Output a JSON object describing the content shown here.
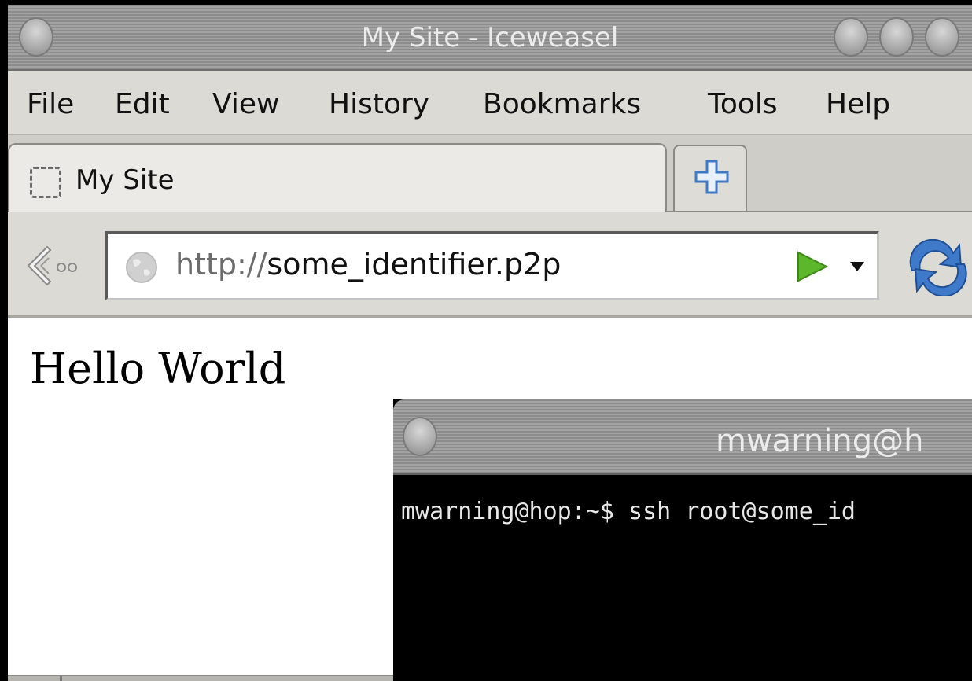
{
  "browser": {
    "window_title": "My Site - Iceweasel",
    "menu": [
      {
        "label": "File"
      },
      {
        "label": "Edit"
      },
      {
        "label": "View"
      },
      {
        "label": "History"
      },
      {
        "label": "Bookmarks"
      },
      {
        "label": "Tools"
      },
      {
        "label": "Help"
      }
    ],
    "tab": {
      "label": "My Site"
    },
    "url": {
      "scheme": "http://",
      "rest": "some_identifier.p2p"
    },
    "page": {
      "heading": "Hello World"
    }
  },
  "terminal": {
    "window_title": "mwarning@h",
    "prompt_line": "mwarning@hop:~$ ssh root@some_id"
  },
  "colors": {
    "go_arrow": "#5cb82a",
    "reload_blue": "#3f79c9",
    "newtab_plus": "#3d79c4",
    "terminal_bg": "#000000"
  }
}
